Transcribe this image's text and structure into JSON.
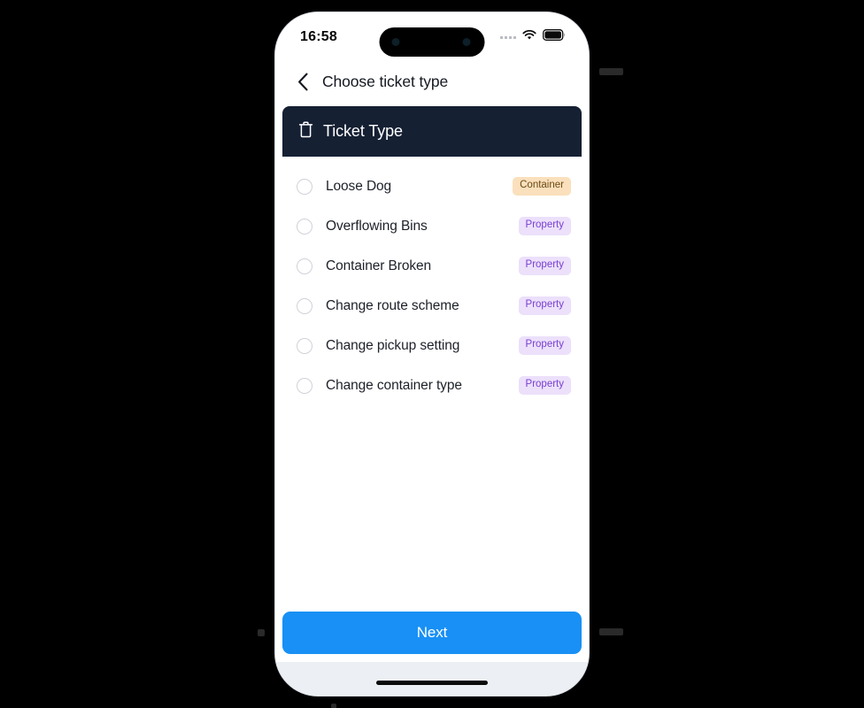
{
  "status_bar": {
    "time": "16:58",
    "cellular_icon": "signal-dots-icon",
    "wifi_icon": "wifi-icon",
    "battery_icon": "battery-full-icon"
  },
  "nav": {
    "back_icon": "chevron-left-icon",
    "title": "Choose ticket type"
  },
  "card": {
    "header_icon": "trash-icon",
    "header_title": "Ticket Type",
    "options": [
      {
        "label": "Loose Dog",
        "badge": "Container",
        "badge_kind": "container",
        "selected": false,
        "radio_icon": "radio-unchecked-icon"
      },
      {
        "label": "Overflowing Bins",
        "badge": "Property",
        "badge_kind": "property",
        "selected": false,
        "radio_icon": "radio-unchecked-icon"
      },
      {
        "label": "Container Broken",
        "badge": "Property",
        "badge_kind": "property",
        "selected": false,
        "radio_icon": "radio-unchecked-icon"
      },
      {
        "label": "Change route scheme",
        "badge": "Property",
        "badge_kind": "property",
        "selected": false,
        "radio_icon": "radio-unchecked-icon"
      },
      {
        "label": "Change pickup setting",
        "badge": "Property",
        "badge_kind": "property",
        "selected": false,
        "radio_icon": "radio-unchecked-icon"
      },
      {
        "label": "Change container type",
        "badge": "Property",
        "badge_kind": "property",
        "selected": false,
        "radio_icon": "radio-unchecked-icon"
      }
    ]
  },
  "footer": {
    "next_label": "Next"
  },
  "colors": {
    "header_navy": "#152033",
    "primary_blue": "#1890f5",
    "badge_container_bg": "#fae0bc",
    "badge_container_fg": "#6d4a14",
    "badge_property_bg": "#ece0fb",
    "badge_property_fg": "#7a3fd1",
    "page_background": "#000000",
    "device_body": "#eceff3"
  }
}
